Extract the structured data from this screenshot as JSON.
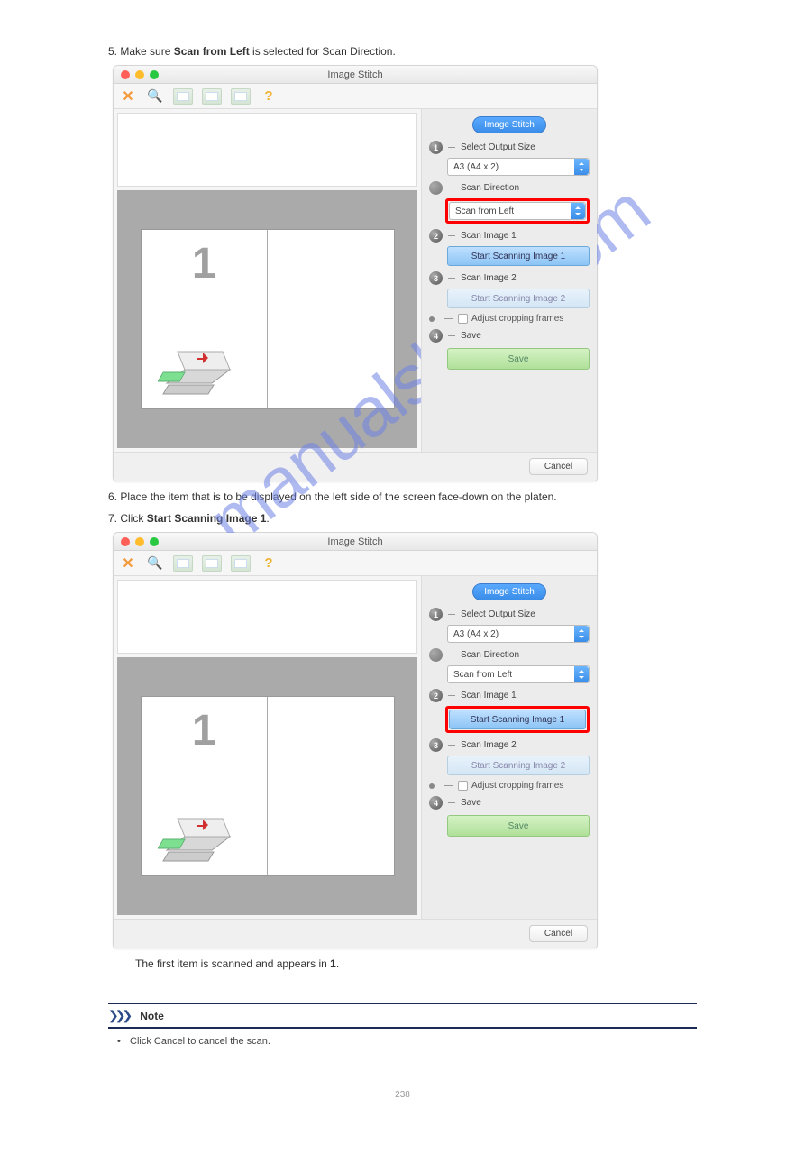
{
  "watermark": "manualshive.com",
  "window": {
    "title": "Image Stitch",
    "badge": "Image Stitch",
    "step1_label": "Select Output Size",
    "output_size_value": "A3 (A4 x 2)",
    "direction_label": "Scan Direction",
    "direction_value": "Scan from Left",
    "step2_label": "Scan Image 1",
    "btn_scan1": "Start Scanning Image 1",
    "step3_label": "Scan Image 2",
    "btn_scan2": "Start Scanning Image 2",
    "adjust_crop_label": "Adjust cropping frames",
    "step4_label": "Save",
    "btn_save": "Save",
    "btn_cancel": "Cancel",
    "placeholder_digit": "1"
  },
  "instr1_prefix": "5. Make sure ",
  "instr1_bold": "Scan from Left",
  "instr1_suffix": " is selected for Scan Direction.",
  "instr2_prefix": "6. Place the item that is to be displayed on the left side of the screen face-down on the platen.",
  "instr3_prefix": "7. Click ",
  "instr3_bold": "Start Scanning Image 1",
  "instr3_suffix": ".",
  "after_scan_text": "The first item is scanned and appears in ",
  "after_scan_bold": "1",
  "after_scan_suffix": ".",
  "note": {
    "title": "Note",
    "body": "Click Cancel to cancel the scan."
  },
  "page_number": "238"
}
